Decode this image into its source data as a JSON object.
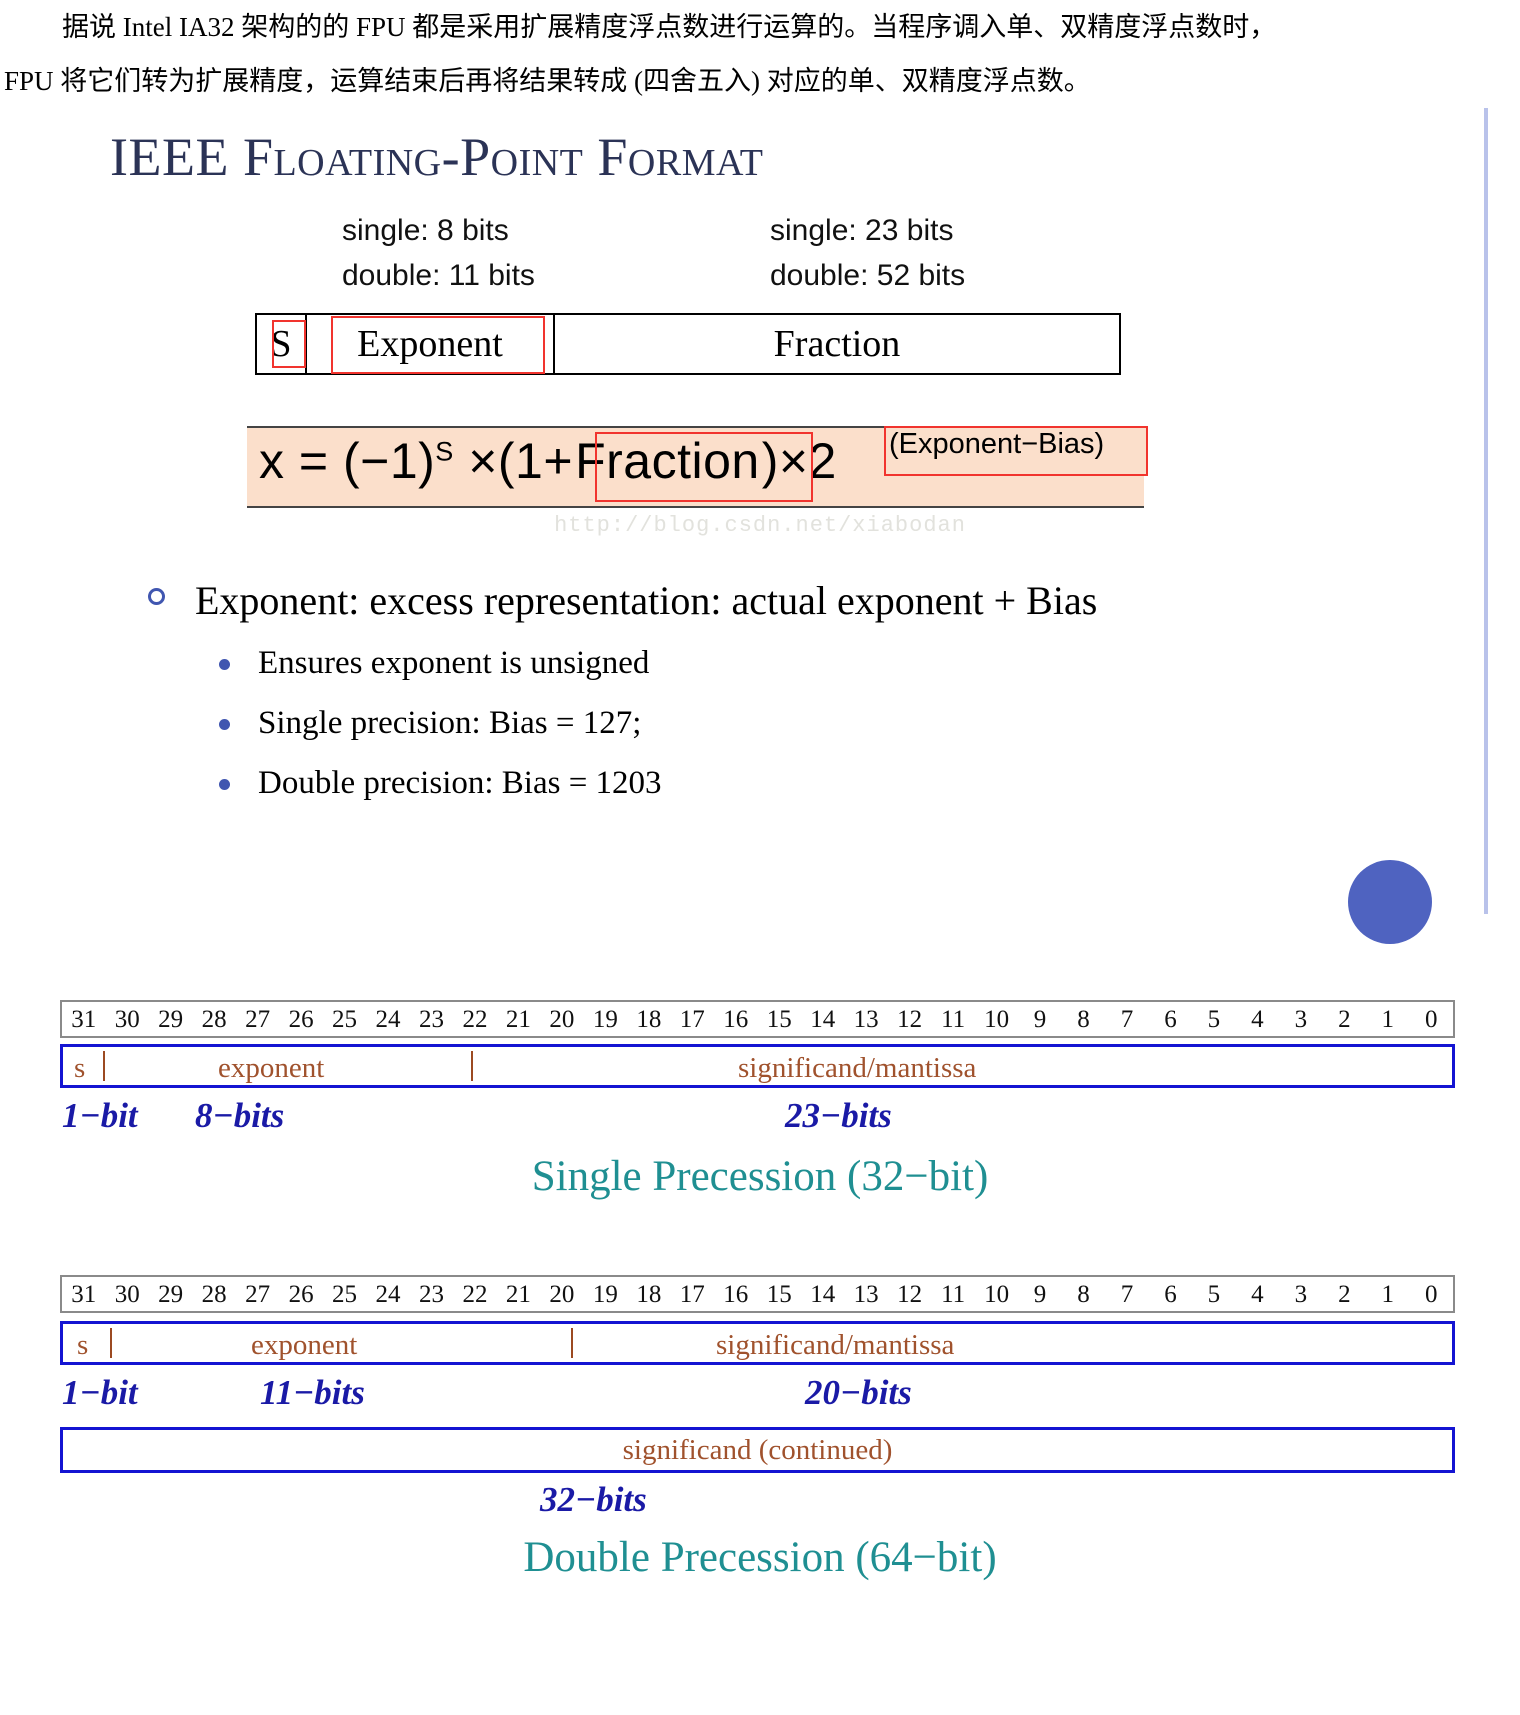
{
  "intro": {
    "line1": "据说 Intel IA32 架构的的 FPU 都是采用扩展精度浮点数进行运算的。当程序调入单、双精度浮点数时，",
    "line2": "FPU 将它们转为扩展精度，运算结束后再将结果转成 (四舍五入) 对应的单、双精度浮点数。"
  },
  "slide": {
    "title": "IEEE Floating-Point Format",
    "legend": {
      "exponent_single": "single: 8 bits",
      "exponent_double": "double: 11 bits",
      "fraction_single": "single: 23 bits",
      "fraction_double": "double: 52 bits"
    },
    "format_box": {
      "sign": "S",
      "exponent": "Exponent",
      "fraction": "Fraction"
    },
    "formula": {
      "lead": "x = (−1)",
      "sup_s": "S",
      "mid_open": " ×(1+",
      "fraction_term": "Fraction",
      "mid_close": ")×2",
      "exponent_superscript": "(Exponent−Bias)"
    },
    "watermark": "http://blog.csdn.net/xiabodan",
    "bullets": {
      "main": "Exponent: excess representation: actual exponent + Bias",
      "sub": [
        "Ensures exponent is unsigned",
        "Single precision: Bias = 127;",
        "Double precision: Bias = 1203"
      ]
    },
    "accent_color": "#4f63c0",
    "accent_line_color": "#b9c2ea",
    "title_color": "#2b3356",
    "formula_bg": "#fbdfcb",
    "annotation_color": "#f1342e"
  },
  "bit_numbers": [
    "31",
    "30",
    "29",
    "28",
    "27",
    "26",
    "25",
    "24",
    "23",
    "22",
    "21",
    "20",
    "19",
    "18",
    "17",
    "16",
    "15",
    "14",
    "13",
    "12",
    "11",
    "10",
    "9",
    "8",
    "7",
    "6",
    "5",
    "4",
    "3",
    "2",
    "1",
    "0"
  ],
  "single_precision": {
    "sign_label": "s",
    "exponent_label": "exponent",
    "significand_label": "significand/mantissa",
    "size_labels": [
      "1−bit",
      "8−bits",
      "23−bits"
    ],
    "caption": "Single Precession (32−bit)"
  },
  "double_precision": {
    "sign_label": "s",
    "exponent_label": "exponent",
    "significand_label": "significand/mantissa",
    "size_labels": [
      "1−bit",
      "11−bits",
      "20−bits"
    ],
    "continued_label": "significand (continued)",
    "continued_size_label": "32−bits",
    "caption": "Double Precession (64−bit)"
  },
  "colors": {
    "field_border": "#1414d2",
    "field_text": "#a0522d",
    "bits_label": "#1a1aa6",
    "caption": "#1f8f92"
  }
}
